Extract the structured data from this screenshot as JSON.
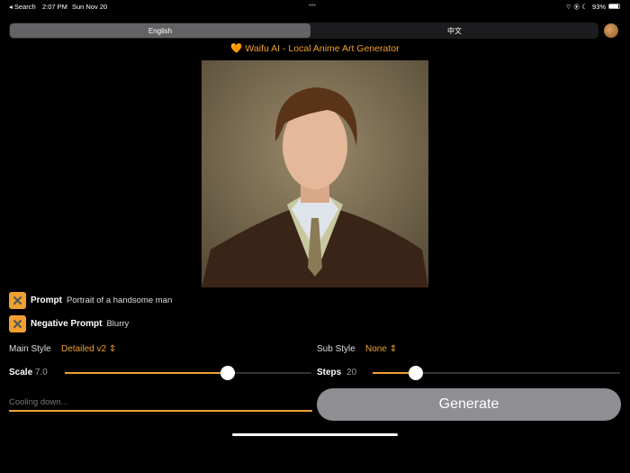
{
  "status_bar": {
    "back": "◂ Search",
    "time": "2:07 PM",
    "date": "Sun Nov 20",
    "battery": "93%",
    "dots": "•••"
  },
  "language": {
    "options": [
      "English",
      "中文"
    ],
    "selected": "English"
  },
  "title": "Waifu AI - Local Anime Art Generator",
  "prompt": {
    "label": "Prompt",
    "value": "Portrait of a handsome man"
  },
  "negative_prompt": {
    "label": "Negative Prompt",
    "value": "Blurry"
  },
  "main_style": {
    "label": "Main Style",
    "value": "Detailed v2"
  },
  "sub_style": {
    "label": "Sub Style",
    "value": "None"
  },
  "scale": {
    "label": "Scale",
    "value": "7.0",
    "fraction": 0.66
  },
  "steps": {
    "label": "Steps",
    "value": "20",
    "fraction": 0.175
  },
  "status": {
    "text": "Cooling down...",
    "progress": 1.0
  },
  "generate_label": "Generate",
  "colors": {
    "accent": "#f0a030",
    "button": "#8e8e93"
  }
}
